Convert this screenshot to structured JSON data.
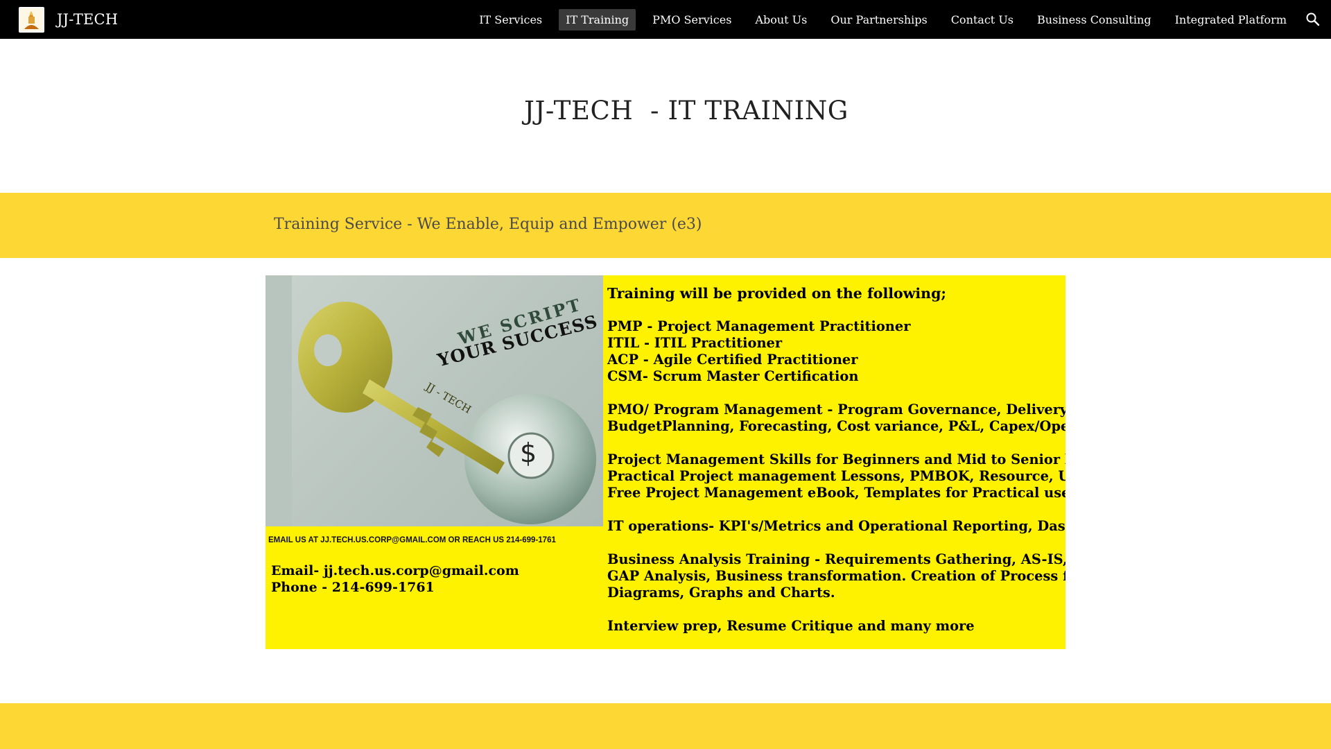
{
  "header": {
    "site_title": "JJ-TECH",
    "logo_icon": "jj-tech-logo-icon",
    "nav_items": [
      {
        "label": "IT Services",
        "active": false
      },
      {
        "label": "IT Training",
        "active": true
      },
      {
        "label": "PMO Services",
        "active": false
      },
      {
        "label": "About Us",
        "active": false
      },
      {
        "label": "Our Partnerships",
        "active": false
      },
      {
        "label": "Contact Us",
        "active": false
      },
      {
        "label": "Business Consulting",
        "active": false
      },
      {
        "label": "Integrated Platform",
        "active": false
      }
    ],
    "search_icon": "search-icon"
  },
  "main": {
    "page_title": "JJ-TECH  - IT TRAINING",
    "banner_text": "Training Service - We Enable, Equip and Empower (e3)"
  },
  "training_image": {
    "slogan_line1": "WE SCRIPT",
    "slogan_line2": "YOUR SUCCESS",
    "key_label": "JJ - TECH",
    "dollar_sign": "$",
    "email_line": "EMAIL US AT JJ.TECH.US.CORP@GMAIL.COM OR REACH US 214-699-1761",
    "contact_email": "Email- jj.tech.us.corp@gmail.com",
    "contact_phone": "Phone - 214-699-1761",
    "list_heading": "Training will be provided on the following;",
    "certifications": [
      "PMP - Project Management Practitioner",
      "ITIL - ITIL Practitioner",
      "ACP - Agile Certified Practitioner",
      "CSM- Scrum Master Certification"
    ],
    "pmo": [
      "PMO/ Program Management - Program Governance, Delivery,",
      "BudgetPlanning, Forecasting, Cost variance, P&L, Capex/Opex"
    ],
    "pm_skills": [
      "Project Management Skills for Beginners and Mid to Senior level exec's-",
      "Practical Project management Lessons, PMBOK,  Resource, Utilization",
      "Free Project Management eBook, Templates for Practical use - RAID log"
    ],
    "it_ops": "IT operations- KPI's/Metrics and Operational Reporting, Dashboards",
    "ba": [
      "Business Analysis Training - Requirements Gathering, AS-IS, TO-BE,",
      "GAP Analysis, Business transformation. Creation of Process flow",
      "Diagrams, Graphs and Charts."
    ],
    "interview": "Interview prep, Resume Critique and many more"
  },
  "colors": {
    "topbar": "#000000",
    "banner": "#fdd835",
    "image_yellow": "#fff200",
    "active_nav": "#3a3a3a"
  }
}
